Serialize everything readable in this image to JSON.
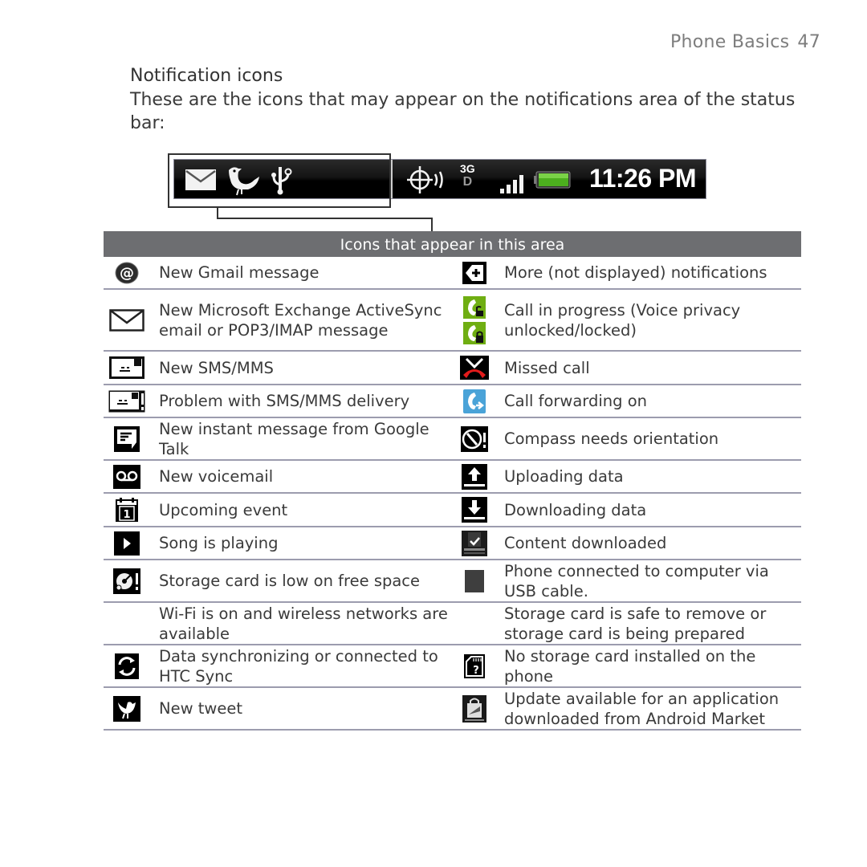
{
  "page_header": {
    "section": "Phone Basics",
    "page_number": "47"
  },
  "section_title": "Notification icons",
  "intro_text": "These are the icons that may appear on the notifications area of the status bar:",
  "status_bar": {
    "notification_icons": [
      "envelope-icon",
      "twitter-bird-icon",
      "usb-icon"
    ],
    "status_icons": [
      "gps-icon",
      "3g-data-icon",
      "signal-strength-icon",
      "battery-icon"
    ],
    "network_label_top": "3G",
    "network_label_bottom": "D",
    "time": "11:26 PM",
    "battery_color": "#4caf1e"
  },
  "table": {
    "header": "Icons that appear in this area",
    "header_color": "#6d6e71",
    "rows": [
      {
        "left": {
          "icon": "gmail-at-icon",
          "label": "New Gmail message"
        },
        "right": {
          "icon": "more-notifications-icon",
          "label": "More (not displayed) notifications"
        }
      },
      {
        "left": {
          "icon": "email-envelope-icon",
          "label": "New Microsoft Exchange ActiveSync email or POP3/IMAP message"
        },
        "right": {
          "icon": "call-in-progress-icon",
          "label": "Call in progress (Voice privacy unlocked/locked)"
        }
      },
      {
        "left": {
          "icon": "sms-icon",
          "label": "New SMS/MMS"
        },
        "right": {
          "icon": "missed-call-icon",
          "label": "Missed call"
        }
      },
      {
        "left": {
          "icon": "sms-problem-icon",
          "label": "Problem with SMS/MMS delivery"
        },
        "right": {
          "icon": "call-forwarding-icon",
          "label": "Call forwarding on"
        }
      },
      {
        "left": {
          "icon": "google-talk-icon",
          "label": "New instant message from Google Talk"
        },
        "right": {
          "icon": "compass-icon",
          "label": "Compass needs orientation"
        }
      },
      {
        "left": {
          "icon": "voicemail-icon",
          "label": "New voicemail"
        },
        "right": {
          "icon": "upload-icon",
          "label": "Uploading data"
        }
      },
      {
        "left": {
          "icon": "calendar-icon",
          "label": "Upcoming event"
        },
        "right": {
          "icon": "download-icon",
          "label": "Downloading data"
        }
      },
      {
        "left": {
          "icon": "play-icon",
          "label": "Song is playing"
        },
        "right": {
          "icon": "content-downloaded-icon",
          "label": "Content downloaded"
        }
      },
      {
        "left": {
          "icon": "storage-low-icon",
          "label": "Storage card is low on free space"
        },
        "right": {
          "icon": "usb-connected-icon",
          "label": "Phone connected to computer via USB cable."
        }
      },
      {
        "left": {
          "icon": "",
          "label": "Wi-Fi is on and wireless networks are available"
        },
        "right": {
          "icon": "",
          "label": "Storage card is safe to remove or storage card is being prepared"
        }
      },
      {
        "left": {
          "icon": "sync-icon",
          "label": "Data synchronizing or connected to HTC Sync"
        },
        "right": {
          "icon": "no-storage-card-icon",
          "label": "No storage card installed on the phone"
        }
      },
      {
        "left": {
          "icon": "tweet-icon",
          "label": "New tweet"
        },
        "right": {
          "icon": "app-update-icon",
          "label": "Update available for an application downloaded from Android Market"
        }
      }
    ]
  }
}
